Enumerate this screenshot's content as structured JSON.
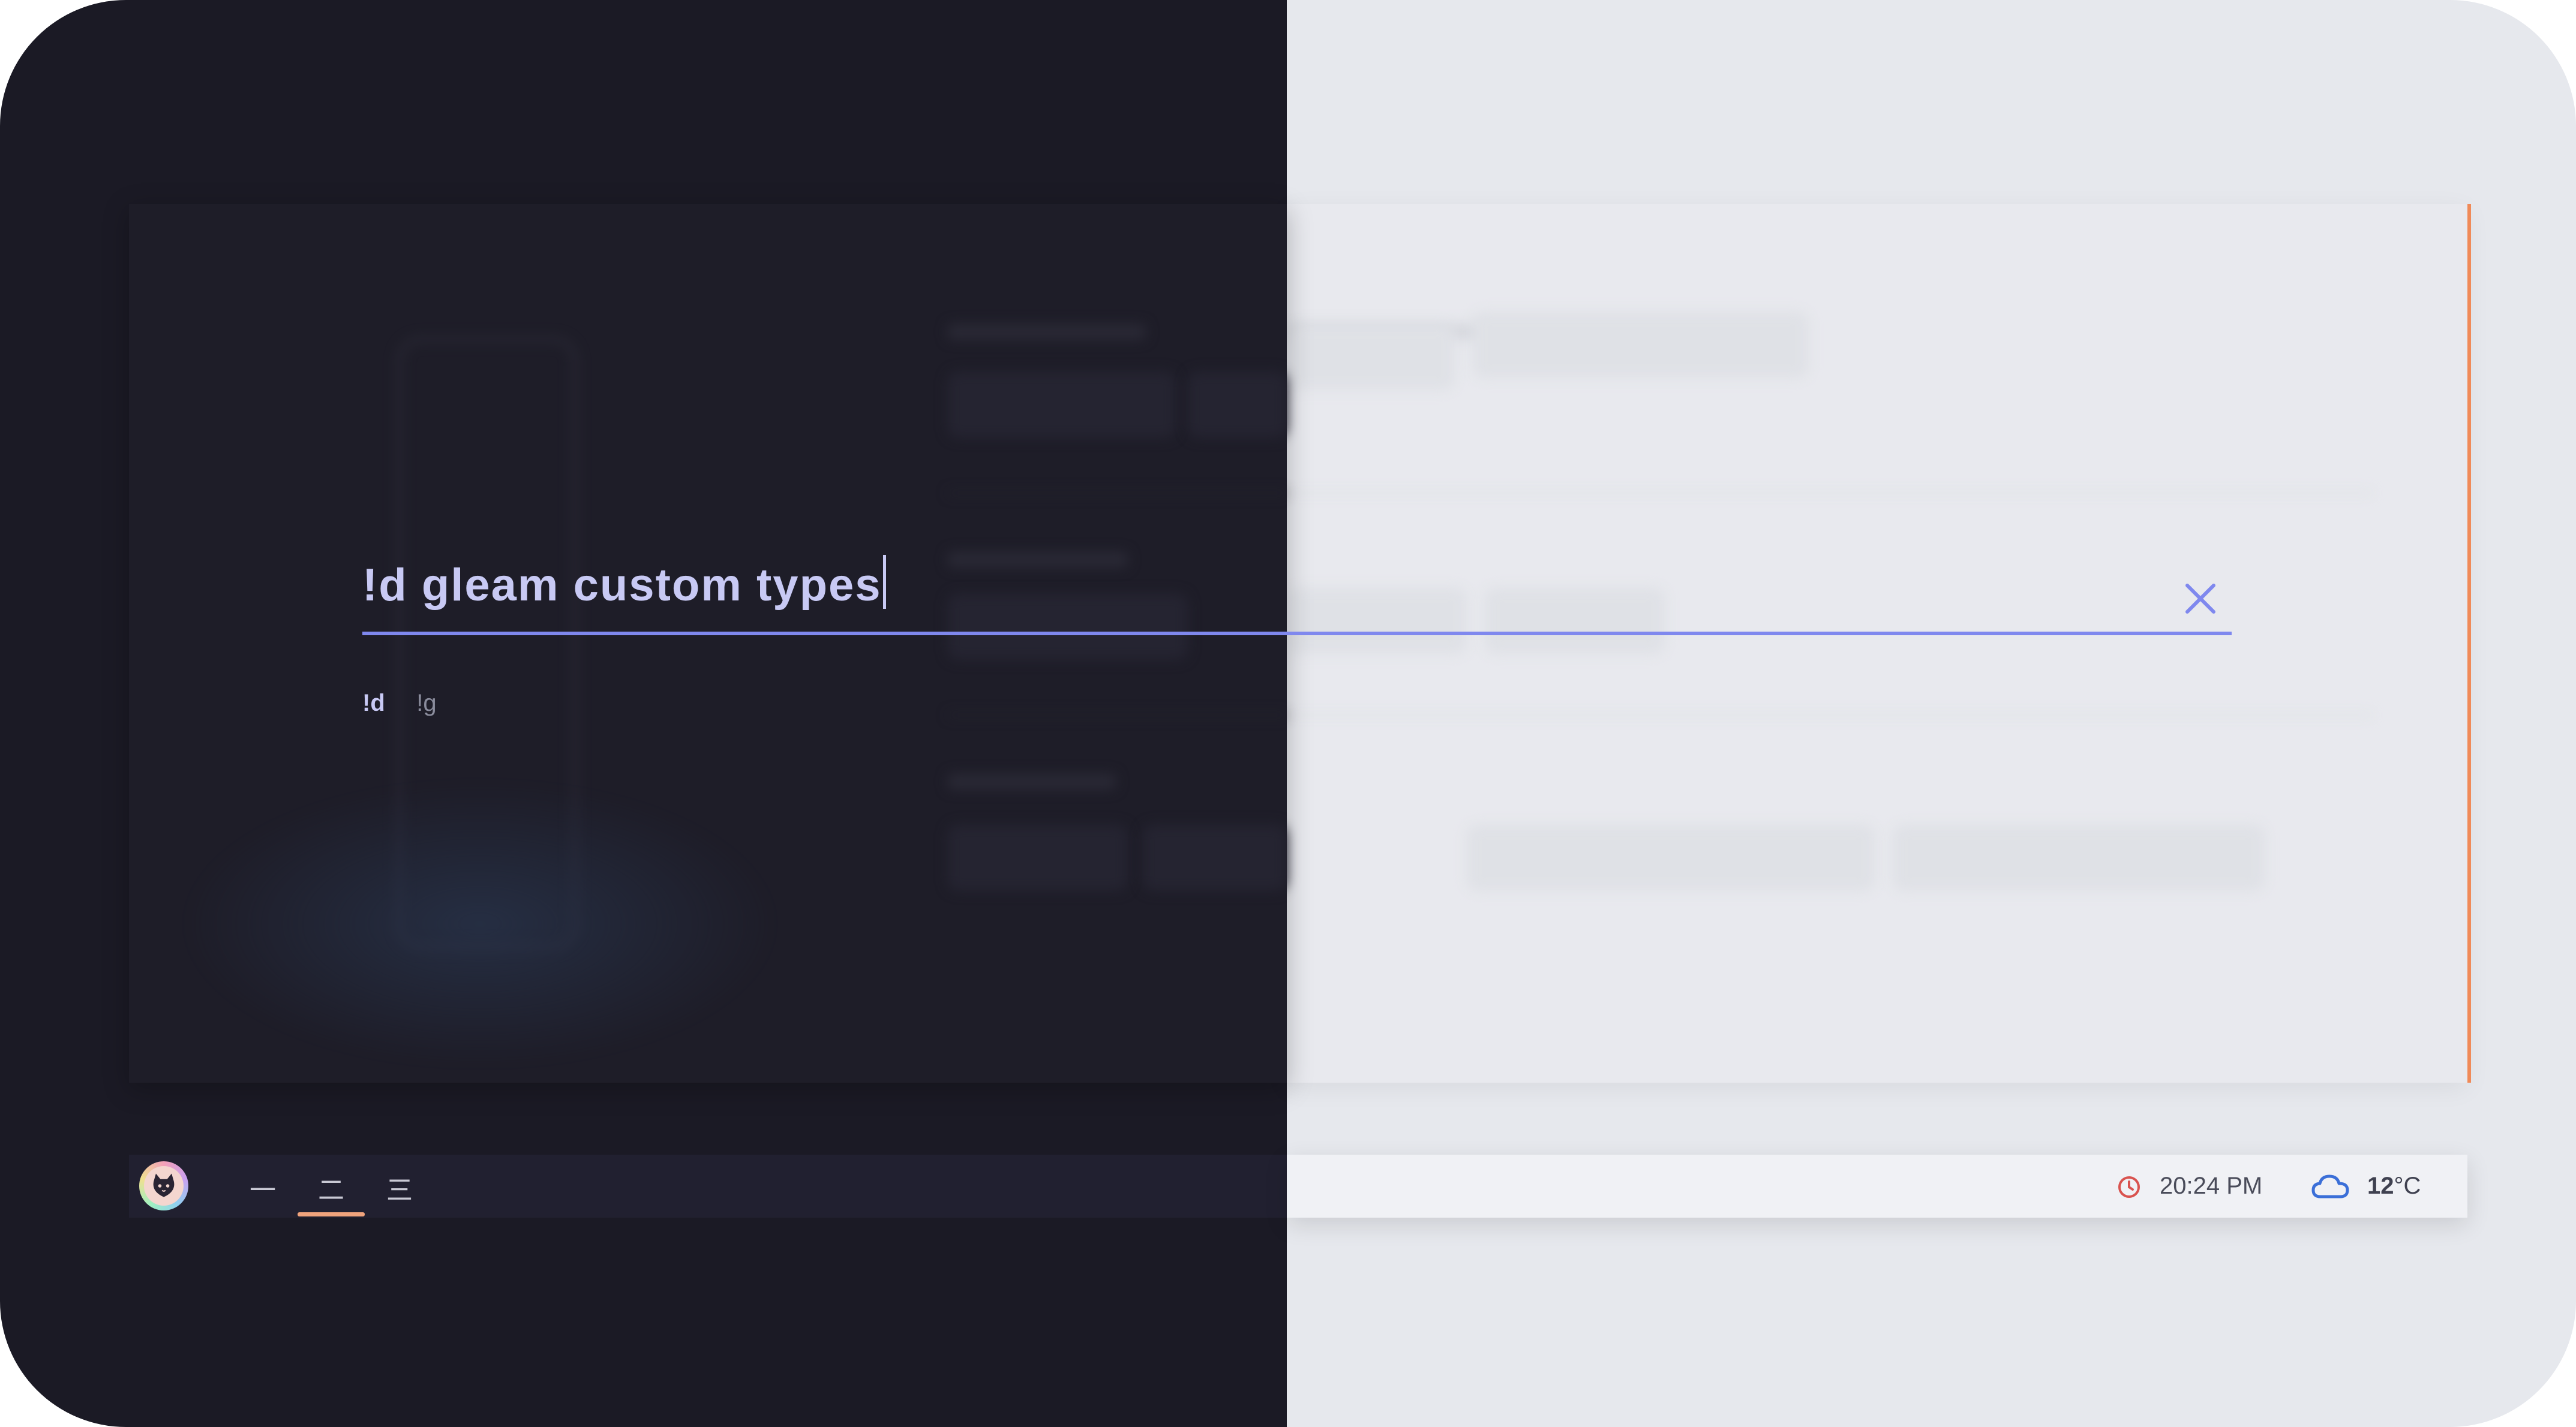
{
  "search": {
    "query": "!d gleam custom types",
    "suggestions": [
      "!d",
      "!g"
    ],
    "accent": "#7f88ee",
    "text_color": "#c8c9f4"
  },
  "taskbar": {
    "workspaces": [
      "一",
      "二",
      "三"
    ],
    "active_workspace": 1,
    "indicator_color": "#f0a37c",
    "clock": "20:24 PM",
    "weather_value": "12",
    "weather_unit": "°C",
    "weather_icon": "cloud-icon",
    "clock_icon": "clock-icon"
  },
  "theme": {
    "dark_bg": "#1b1a25",
    "light_bg": "#e6e8ed",
    "card_edge": "#f08a58"
  }
}
